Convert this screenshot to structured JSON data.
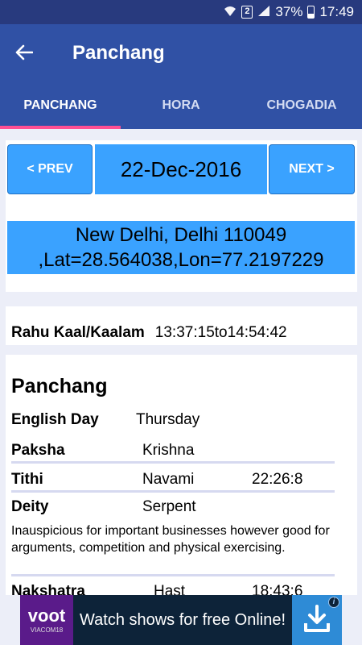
{
  "status_bar": {
    "battery": "37%",
    "time": "17:49",
    "sim": "2"
  },
  "app_bar": {
    "title": "Panchang"
  },
  "tabs": [
    {
      "label": "PANCHANG",
      "active": true
    },
    {
      "label": "HORA",
      "active": false
    },
    {
      "label": "CHOGADIA",
      "active": false
    }
  ],
  "nav": {
    "prev_label": "< PREV",
    "date": "22-Dec-2016",
    "next_label": "NEXT >"
  },
  "location": {
    "line1": "New Delhi, Delhi 110049",
    "line2": ",Lat=28.564038,Lon=77.2197229"
  },
  "rahu": {
    "label": "Rahu Kaal/Kaalam",
    "start": "13:37:15",
    "separator": "to",
    "end": "14:54:42"
  },
  "panchang": {
    "heading": "Panchang",
    "english_day": {
      "label": "English Day",
      "value": "Thursday"
    },
    "paksha": {
      "label": "Paksha",
      "value": "Krishna"
    },
    "tithi": {
      "label": "Tithi",
      "value": "Navami",
      "time": "22:26:8"
    },
    "deity": {
      "label": "Deity",
      "value": "Serpent",
      "description": "Inauspicious for important businesses however good for arguments, competition and physical exercising."
    },
    "nakshatra": {
      "label": "Nakshatra",
      "value": "Hast",
      "time": "18:43:6"
    }
  },
  "ad": {
    "brand": "voot",
    "brand_sub": "VIACOM18",
    "text": "Watch shows for free Online!",
    "info": "i"
  },
  "colors": {
    "status_bar": "#283a7e",
    "app_bar": "#3051a5",
    "tab_indicator": "#ff4f93",
    "button_blue": "#3aa2ff",
    "background": "#eceef8"
  },
  "icons": [
    "back-arrow-icon",
    "wifi-icon",
    "sim-icon",
    "signal-icon",
    "battery-icon",
    "download-icon",
    "info-icon"
  ]
}
